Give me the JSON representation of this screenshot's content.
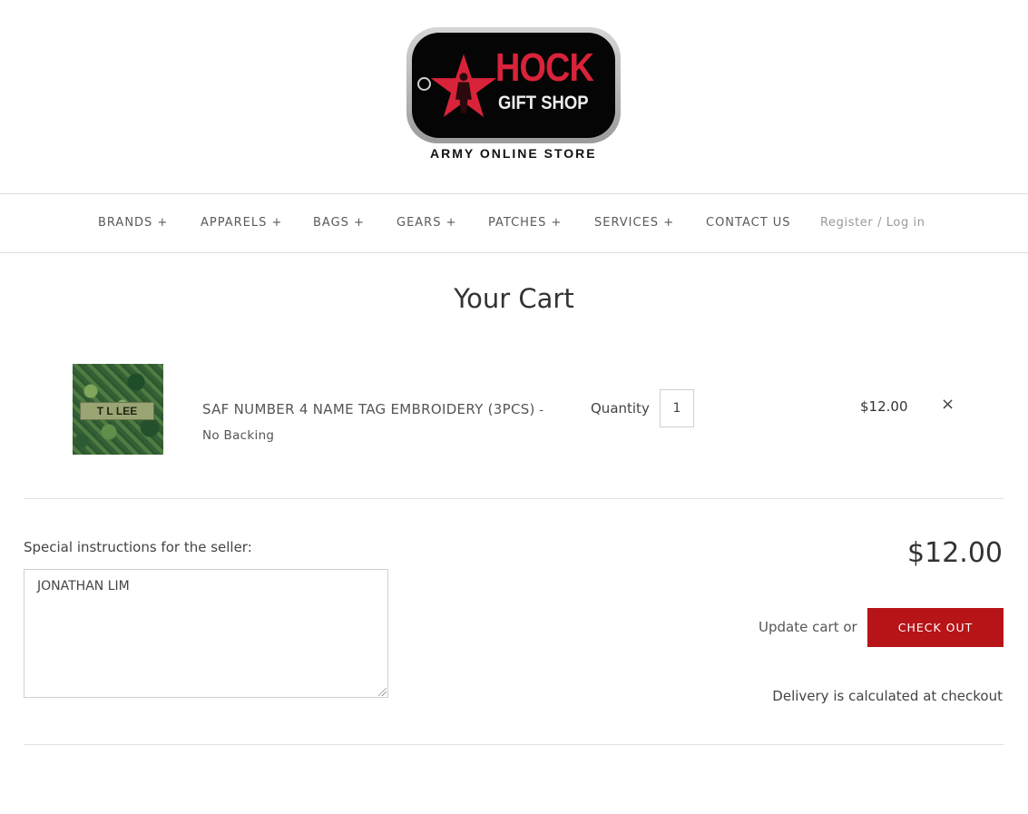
{
  "brand": {
    "logo_main": "HOCK",
    "logo_sub": "GIFT SHOP",
    "logo_tagline": "ARMY ONLINE STORE",
    "accent_color": "#d8233a"
  },
  "nav": {
    "items": [
      {
        "label": "BRANDS +"
      },
      {
        "label": "APPARELS +"
      },
      {
        "label": "BAGS +"
      },
      {
        "label": "GEARS +"
      },
      {
        "label": "PATCHES +"
      },
      {
        "label": "SERVICES +"
      },
      {
        "label": "CONTACT US"
      }
    ],
    "register": "Register",
    "separator": "/",
    "login": "Log in"
  },
  "page": {
    "title": "Your Cart"
  },
  "cart": {
    "item": {
      "thumbnail_text": "T L LEE",
      "title": "SAF NUMBER 4 NAME TAG EMBROIDERY (3PCS)",
      "variant_sep": " - ",
      "variant": "No Backing",
      "quantity_label": "Quantity",
      "quantity": "1",
      "price": "$12.00",
      "remove_icon": "×"
    },
    "notes_label": "Special instructions for the seller:",
    "notes_value": "JONATHAN LIM",
    "subtotal": "$12.00",
    "update_label": "Update cart",
    "or_text": "or",
    "checkout_label": "CHECK OUT",
    "checkout_color": "#b71418",
    "delivery_note": "Delivery is calculated at checkout"
  }
}
